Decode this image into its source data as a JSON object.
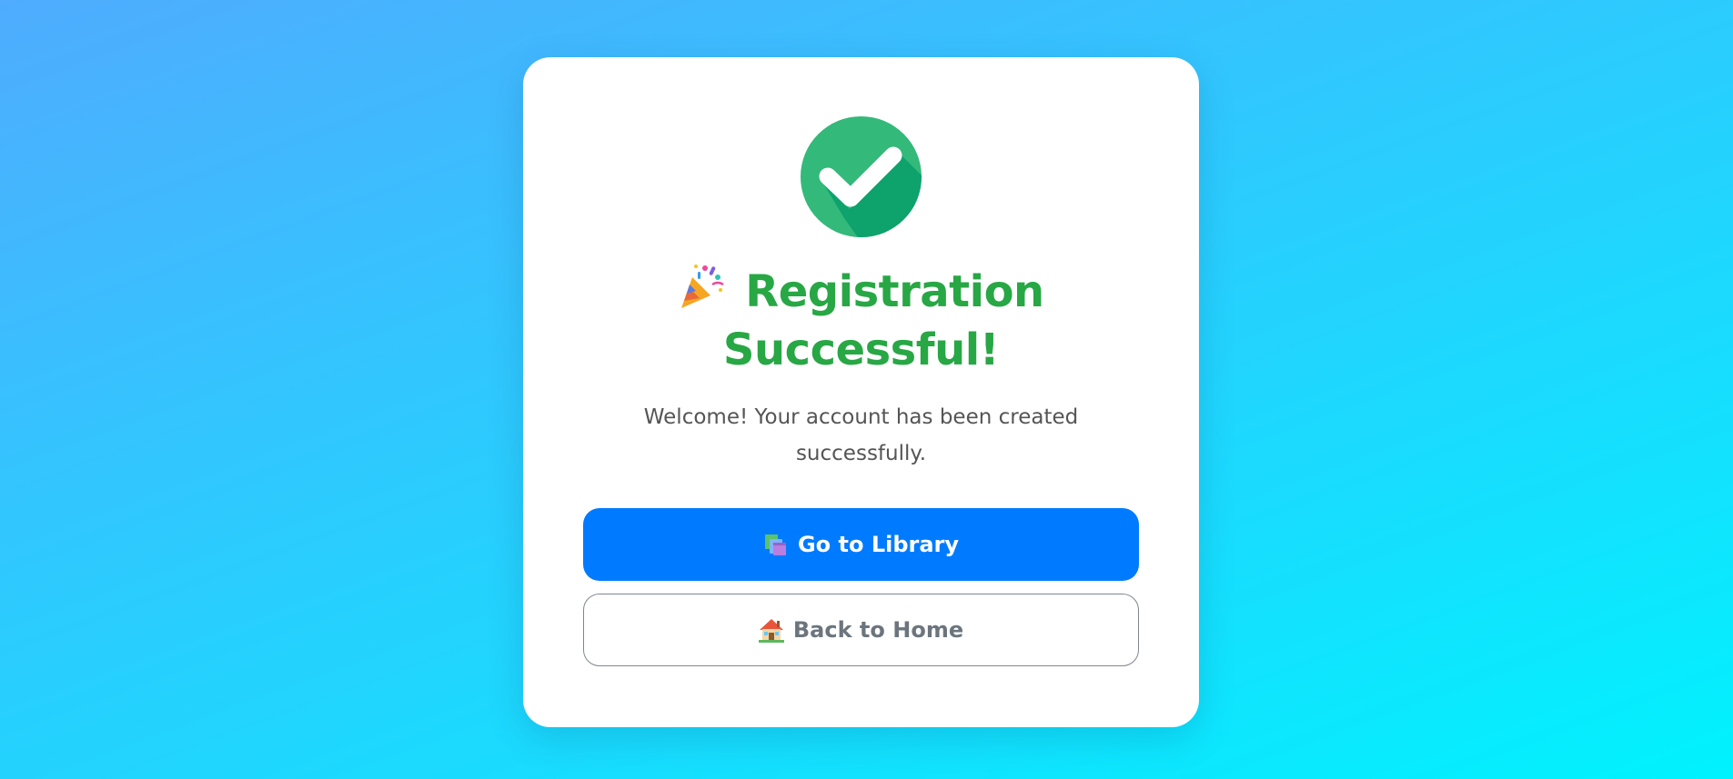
{
  "success": {
    "title": "Registration Successful!",
    "message": "Welcome! Your account has been created successfully."
  },
  "buttons": {
    "primary_label": "Go to Library",
    "secondary_label": "Back to Home"
  },
  "icons": {
    "status": "check-circle-icon",
    "title": "party-popper-icon",
    "primary": "books-icon",
    "secondary": "house-icon"
  },
  "colors": {
    "success": "#28a745",
    "check_circle": "#33b97a",
    "primary_button": "#007bff",
    "secondary_text": "#6c757d",
    "background_start": "#4facfe",
    "background_end": "#00f2fe"
  }
}
